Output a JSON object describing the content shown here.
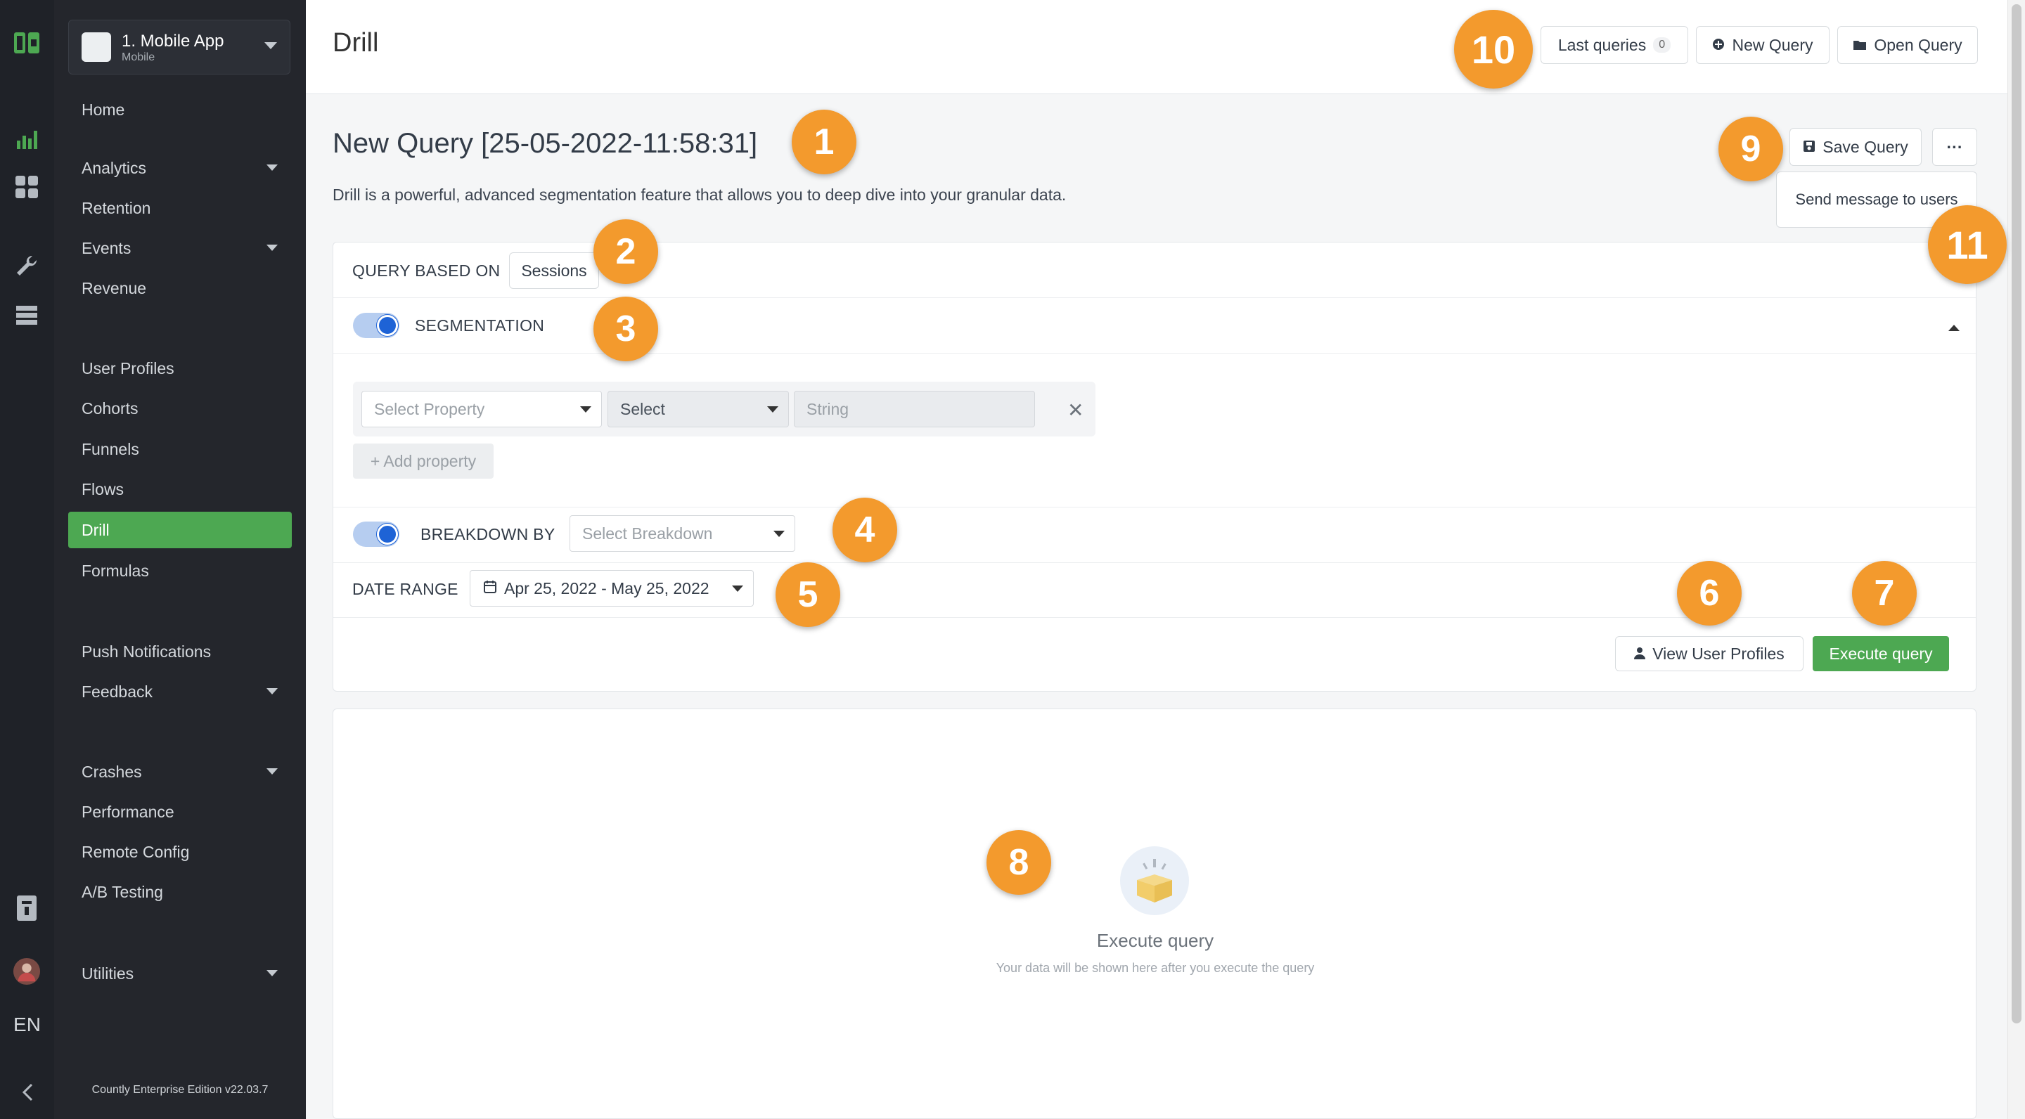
{
  "colors": {
    "accent_green": "#4da852",
    "toggle_blue": "#1e63d6",
    "marker_orange": "#f39a2d",
    "sidebar_bg": "#24262c",
    "rail_bg": "#1f2228"
  },
  "rail": {
    "icons": [
      "countly-logo-icon",
      "bar-chart-icon",
      "dashboard-grid-icon",
      "wrench-icon",
      "database-icon",
      "document-icon",
      "user-avatar-icon",
      "chevron-left-icon"
    ],
    "language": "EN"
  },
  "sidebar": {
    "app": {
      "name": "1. Mobile App",
      "type": "Mobile"
    },
    "items": [
      {
        "label": "Home"
      },
      {
        "label": "Analytics",
        "expandable": true
      },
      {
        "label": "Retention"
      },
      {
        "label": "Events",
        "expandable": true
      },
      {
        "label": "Revenue"
      },
      {
        "label": "User Profiles"
      },
      {
        "label": "Cohorts"
      },
      {
        "label": "Funnels"
      },
      {
        "label": "Flows"
      },
      {
        "label": "Drill",
        "active": true
      },
      {
        "label": "Formulas"
      },
      {
        "label": "Push Notifications"
      },
      {
        "label": "Feedback",
        "expandable": true
      },
      {
        "label": "Crashes",
        "expandable": true
      },
      {
        "label": "Performance"
      },
      {
        "label": "Remote Config"
      },
      {
        "label": "A/B Testing"
      },
      {
        "label": "Utilities",
        "expandable": true
      }
    ],
    "edition": "Countly Enterprise Edition v22.03.7"
  },
  "header": {
    "title": "Drill",
    "last_queries_label": "Last queries",
    "last_queries_count": "0",
    "new_query_label": "New Query",
    "open_query_label": "Open Query"
  },
  "query": {
    "title": "New Query [25-05-2022-11:58:31]",
    "description": "Drill is a powerful, advanced segmentation feature that allows you to deep dive into your granular data.",
    "save_label": "Save Query",
    "more_label": "···",
    "menu_item": "Send message to users",
    "based_on_label": "QUERY BASED ON",
    "based_on_value": "Sessions",
    "segmentation_label": "SEGMENTATION",
    "segmentation_enabled": true,
    "property_placeholder": "Select Property",
    "operator_placeholder": "Select",
    "value_placeholder": "String",
    "add_property_label": "+ Add property",
    "breakdown_label": "BREAKDOWN BY",
    "breakdown_enabled": true,
    "breakdown_placeholder": "Select Breakdown",
    "date_range_label": "DATE RANGE",
    "date_range_value": "Apr 25, 2022 - May 25, 2022",
    "view_profiles_label": "View User Profiles",
    "execute_label": "Execute query"
  },
  "results": {
    "empty_title": "Execute query",
    "empty_subtitle": "Your data will be shown here after you execute the query"
  },
  "markers": [
    "1",
    "2",
    "3",
    "4",
    "5",
    "6",
    "7",
    "8",
    "9",
    "10",
    "11"
  ]
}
